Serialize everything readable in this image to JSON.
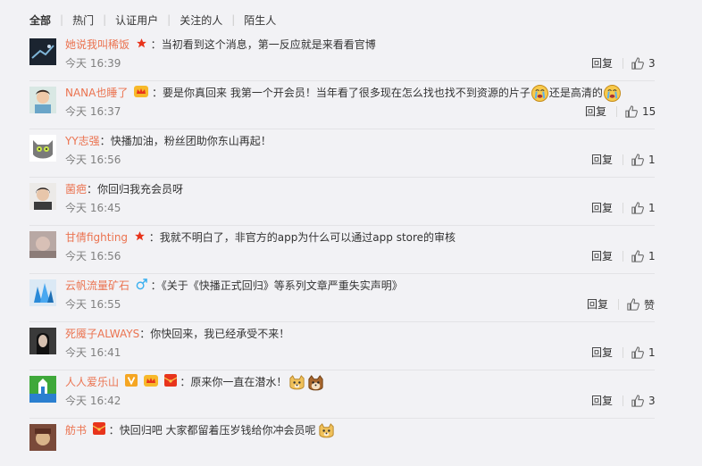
{
  "tabs": [
    "全部",
    "热门",
    "认证用户",
    "关注的人",
    "陌生人"
  ],
  "reply_label": "回复",
  "comments": [
    {
      "user": "她说我叫稀饭",
      "text": "当初看到这个消息，第一反应就是来看看官博",
      "time": "今天 16:39",
      "likes": "3"
    },
    {
      "user": "NANA也睡了",
      "text": "要是你真回来 我第一个开会员！当年看了很多现在怎么找也找不到资源的片子",
      "text2": "还是高清的",
      "time": "今天 16:37",
      "likes": "15"
    },
    {
      "user": "YY志强",
      "text": "快播加油，粉丝团助你东山再起！",
      "time": "今天 16:56",
      "likes": "1"
    },
    {
      "user": "菌疤",
      "text": "你回归我充会员呀",
      "time": "今天 16:45",
      "likes": "1"
    },
    {
      "user": "甘倩fighting",
      "text": "我就不明白了，非官方的app为什么可以通过app store的审核",
      "time": "今天 16:56",
      "likes": "1"
    },
    {
      "user": "云帆流量矿石",
      "text": "《关于《快播正式回归》等系列文章严重失实声明》",
      "time": "今天 16:55",
      "likes": "赞"
    },
    {
      "user": "死魇子ALWAYS",
      "text": "你快回来，我已经承受不来！",
      "time": "今天 16:41",
      "likes": "1"
    },
    {
      "user": "人人爱乐山",
      "text": "原来你一直在潜水！",
      "time": "今天 16:42",
      "likes": "3"
    },
    {
      "user": "舫书",
      "text": "快回归吧 大家都留着压岁钱给你冲会员呢",
      "time": "",
      "likes": ""
    }
  ]
}
